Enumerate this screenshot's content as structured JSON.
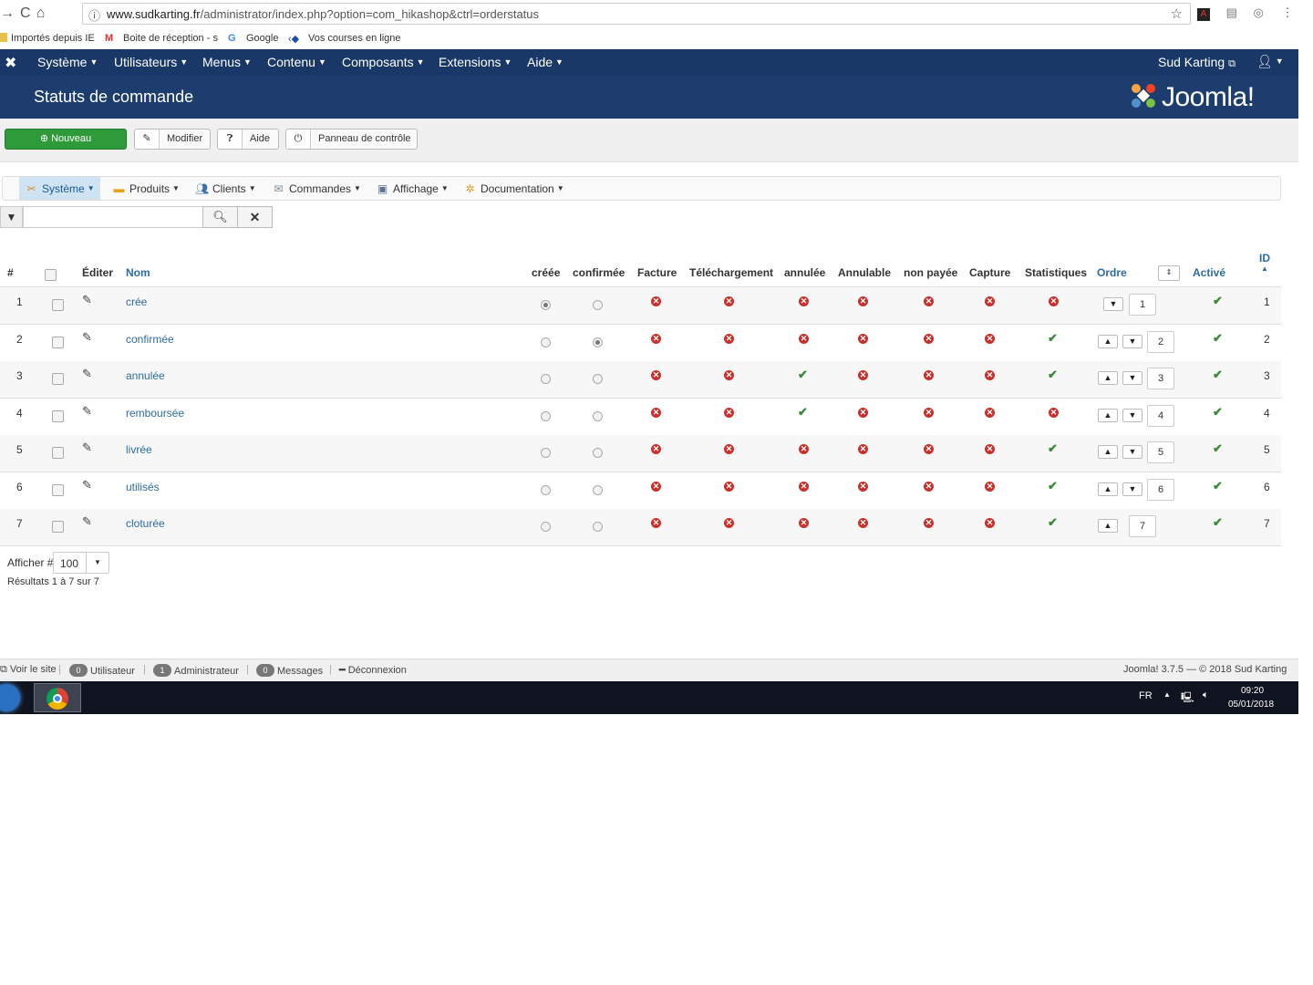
{
  "browser": {
    "url_host": "www.sudkarting.fr",
    "url_path": "/administrator/index.php?option=com_hikashop&ctrl=orderstatus",
    "bookmarks": [
      "Importés depuis IE",
      "Boite de réception - s",
      "Google",
      "Vos courses en ligne"
    ]
  },
  "topnav": {
    "menus": [
      "Système",
      "Utilisateurs",
      "Menus",
      "Contenu",
      "Composants",
      "Extensions",
      "Aide"
    ],
    "site": "Sud Karting"
  },
  "header": {
    "title": "Statuts de commande",
    "logo_text": "Joomla!"
  },
  "toolbar": {
    "new": "Nouveau",
    "edit": "Modifier",
    "help": "Aide",
    "panel": "Panneau de contrôle"
  },
  "hikamenu": {
    "items": [
      "Système",
      "Produits",
      "Clients",
      "Commandes",
      "Affichage",
      "Documentation"
    ]
  },
  "search": {
    "value": ""
  },
  "table": {
    "headers": {
      "num": "#",
      "edit": "Éditer",
      "name": "Nom",
      "creee": "créée",
      "confirmee": "confirmée",
      "facture": "Facture",
      "telechargement": "Téléchargement",
      "annulee": "annulée",
      "annulable": "Annulable",
      "non_payee": "non payée",
      "capture": "Capture",
      "statistiques": "Statistiques",
      "ordre": "Ordre",
      "active": "Activé",
      "id": "ID"
    },
    "rows": [
      {
        "num": "1",
        "name": "crée",
        "default_created": true,
        "default_confirmed": false,
        "facture": false,
        "telechargement": false,
        "annulee": false,
        "annulable": false,
        "non_payee": false,
        "capture": false,
        "statistiques": false,
        "ordre": "1",
        "active": true,
        "id": "1"
      },
      {
        "num": "2",
        "name": "confirmée",
        "default_created": false,
        "default_confirmed": true,
        "facture": false,
        "telechargement": false,
        "annulee": false,
        "annulable": false,
        "non_payee": false,
        "capture": false,
        "statistiques": true,
        "ordre": "2",
        "active": true,
        "id": "2"
      },
      {
        "num": "3",
        "name": "annulée",
        "default_created": false,
        "default_confirmed": false,
        "facture": false,
        "telechargement": false,
        "annulee": true,
        "annulable": false,
        "non_payee": false,
        "capture": false,
        "statistiques": true,
        "ordre": "3",
        "active": true,
        "id": "3"
      },
      {
        "num": "4",
        "name": "remboursée",
        "default_created": false,
        "default_confirmed": false,
        "facture": false,
        "telechargement": false,
        "annulee": true,
        "annulable": false,
        "non_payee": false,
        "capture": false,
        "statistiques": false,
        "ordre": "4",
        "active": true,
        "id": "4"
      },
      {
        "num": "5",
        "name": "livrée",
        "default_created": false,
        "default_confirmed": false,
        "facture": false,
        "telechargement": false,
        "annulee": false,
        "annulable": false,
        "non_payee": false,
        "capture": false,
        "statistiques": true,
        "ordre": "5",
        "active": true,
        "id": "5"
      },
      {
        "num": "6",
        "name": "utilisés",
        "default_created": false,
        "default_confirmed": false,
        "facture": false,
        "telechargement": false,
        "annulee": false,
        "annulable": false,
        "non_payee": false,
        "capture": false,
        "statistiques": true,
        "ordre": "6",
        "active": true,
        "id": "6"
      },
      {
        "num": "7",
        "name": "cloturée",
        "default_created": false,
        "default_confirmed": false,
        "facture": false,
        "telechargement": false,
        "annulee": false,
        "annulable": false,
        "non_payee": false,
        "capture": false,
        "statistiques": true,
        "ordre": "7",
        "active": true,
        "id": "7"
      }
    ]
  },
  "pagination": {
    "limit_label": "Afficher #",
    "limit": "100",
    "results": "Résultats 1 à 7 sur 7"
  },
  "statusbar": {
    "view_site": "Voir le site",
    "visitors_count": "0",
    "visitors": "Utilisateur",
    "admins_count": "1",
    "admins": "Administrateur",
    "messages_count": "0",
    "messages": "Messages",
    "logout": "Déconnexion",
    "copyright": "Joomla! 3.7.5 — © 2018 Sud Karting"
  },
  "taskbar": {
    "lang": "FR",
    "time": "09:20",
    "date": "05/01/2018"
  },
  "colors": {
    "nav_bg": "#1a3867",
    "header_bg": "#1c3d6e",
    "new_button": "#2f9a3a",
    "link": "#2d6ca2",
    "cross": "#c9302c",
    "check": "#3a8a3a"
  }
}
